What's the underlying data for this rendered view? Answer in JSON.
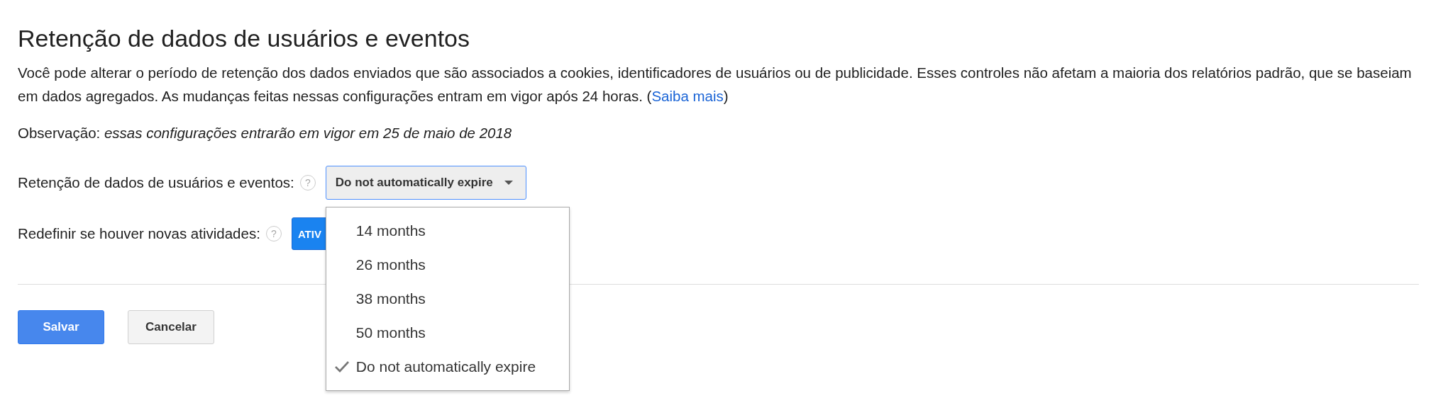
{
  "title": "Retenção de dados de usuários e eventos",
  "description": {
    "text": "Você pode alterar o período de retenção dos dados enviados que são associados a cookies, identificadores de usuários ou de publicidade. Esses controles não afetam a maioria dos relatórios padrão, que se baseiam em dados agregados. As mudanças feitas nessas configurações entram em vigor após 24 horas. (",
    "link": "Saiba mais",
    "after": ")"
  },
  "note": {
    "label": "Observação:",
    "text": "essas configurações entrarão em vigor em 25 de maio de 2018"
  },
  "retention": {
    "label": "Retenção de dados de usuários e eventos:",
    "help": "?",
    "value": "Do not automatically expire",
    "expanded": true,
    "options": [
      {
        "label": "14 months",
        "selected": false
      },
      {
        "label": "26 months",
        "selected": false
      },
      {
        "label": "38 months",
        "selected": false
      },
      {
        "label": "50 months",
        "selected": false
      },
      {
        "label": "Do not automatically expire",
        "selected": true
      }
    ]
  },
  "reset": {
    "label": "Redefinir se houver novas atividades:",
    "help": "?",
    "toggle": "ATIV",
    "on": true
  },
  "buttons": [
    {
      "label": "Salvar",
      "kind": "primary"
    },
    {
      "label": "Cancelar",
      "kind": "secondary"
    }
  ]
}
